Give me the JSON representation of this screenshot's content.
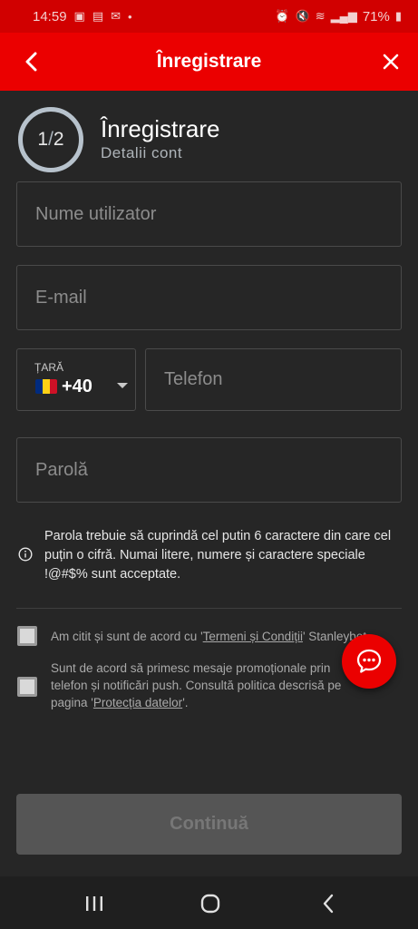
{
  "status_bar": {
    "time": "14:59",
    "battery": "71%"
  },
  "app_bar": {
    "title": "Înregistrare"
  },
  "step": {
    "current": "1",
    "separator": "/",
    "total": "2",
    "title": "Înregistrare",
    "subtitle": "Detalii cont"
  },
  "form": {
    "username_placeholder": "Nume utilizator",
    "email_placeholder": "E-mail",
    "country_label": "ȚARĂ",
    "country_code": "+40",
    "phone_placeholder": "Telefon",
    "password_placeholder": "Parolă"
  },
  "password_info": "Parola trebuie să cuprindă cel putin 6 caractere din care cel puțin o cifră. Numai litere, numere și caractere speciale !@#$% sunt acceptate.",
  "consent": {
    "terms_prefix": "Am citit și sunt de acord cu '",
    "terms_link": "Termeni și Condiții",
    "terms_suffix": "' Stanleybet.",
    "promo_prefix": "Sunt de acord să primesc mesaje promoționale prin telefon și notificări push. Consultă politica descrisă pe pagina '",
    "promo_link": "Protecția datelor",
    "promo_suffix": "'."
  },
  "continue_label": "Continuă",
  "colors": {
    "brand_red": "#eb0000",
    "status_red": "#d10000",
    "background": "#262626",
    "button_disabled": "#555555"
  },
  "icons": {
    "back": "chevron-left-icon",
    "close": "close-icon",
    "info": "info-icon",
    "chat": "chat-bubble-icon",
    "nav_recent": "recent-apps-icon",
    "nav_home": "home-icon",
    "nav_back": "nav-back-icon"
  }
}
